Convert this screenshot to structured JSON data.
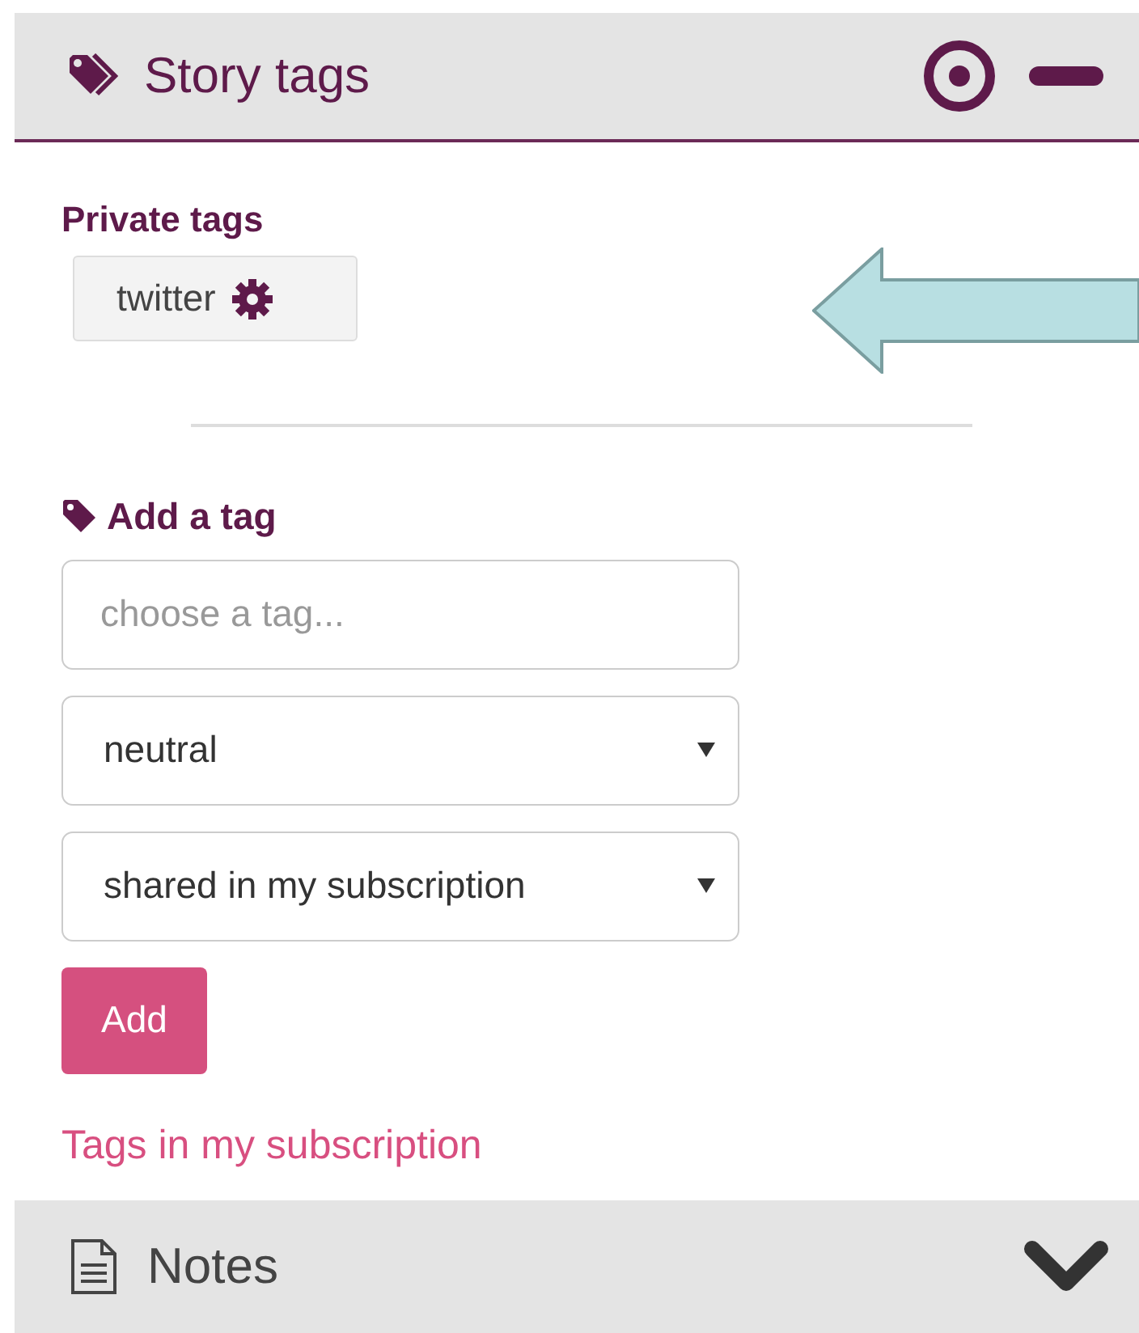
{
  "panel": {
    "title": "Story tags"
  },
  "private_tags": {
    "heading": "Private tags",
    "tags": [
      {
        "label": "twitter"
      }
    ]
  },
  "add_tag": {
    "heading": "Add a tag",
    "input": {
      "placeholder": "choose a tag..."
    },
    "selects": [
      {
        "value": "neutral"
      },
      {
        "value": "shared in my subscription"
      }
    ],
    "button": "Add",
    "link": "Tags in my subscription"
  },
  "notes": {
    "title": "Notes"
  }
}
